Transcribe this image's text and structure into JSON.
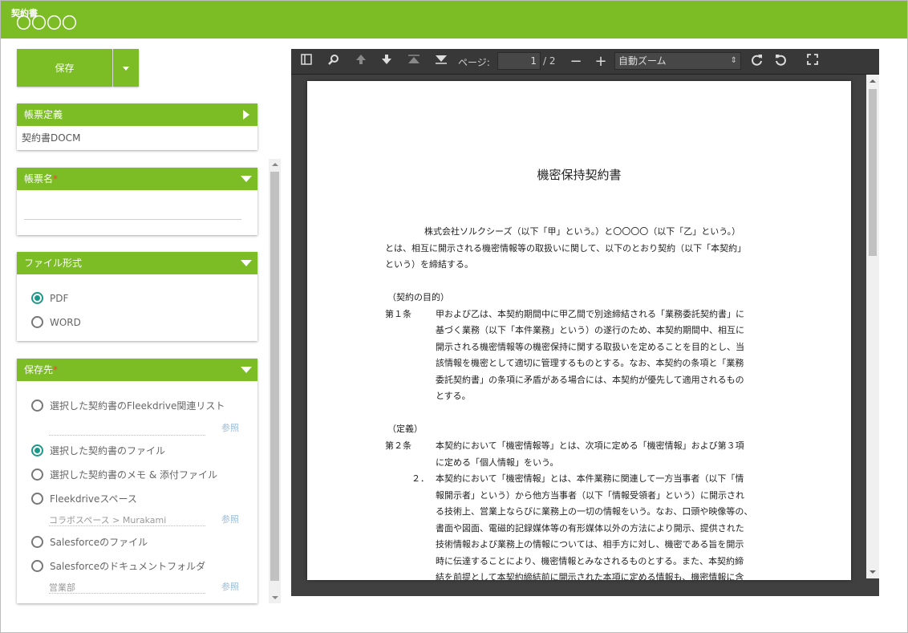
{
  "header": {
    "title": "契約書",
    "subtitle": "〇〇〇〇"
  },
  "toolbar": {
    "save_label": "保存"
  },
  "panels": {
    "definition": {
      "title": "帳票定義",
      "value": "契約書DOCM"
    },
    "name": {
      "title": "帳票名",
      "required_mark": "*",
      "value": ""
    },
    "format": {
      "title": "ファイル形式",
      "options": [
        "PDF",
        "WORD"
      ],
      "selected": "PDF"
    },
    "destination": {
      "title": "保存先",
      "required_mark": "*",
      "options": [
        "選択した契約書のFleekdrive関連リスト",
        "選択した契約書のファイル",
        "選択した契約書のメモ & 添付ファイル",
        "Fleekdriveスペース",
        "Salesforceのファイル",
        "Salesforceのドキュメントフォルダ"
      ],
      "selected": "選択した契約書のファイル",
      "fleekdrive_space_value": "コラボスペース > Murakami",
      "document_folder_value": "営業部",
      "ref_label": "参照"
    }
  },
  "viewer": {
    "page_label": "ページ:",
    "current_page": "1",
    "total_pages": "/ 2",
    "zoom": "自動ズーム",
    "document": {
      "title": "機密保持契約書",
      "lines": [
        "株式会社ソルクシーズ（以下「甲」という。）と〇〇〇〇（以下「乙」という。）",
        "とは、相互に開示される機密情報等の取扱いに関して、以下のとおり契約（以下「本契約」",
        "という）を締結する。",
        "（契約の目的）",
        "第１条",
        "甲および乙は、本契約期間中に甲乙間で別途締結される「業務委託契約書」に",
        "基づく業務（以下「本件業務」という）の遂行のため、本契約期間中、相互に",
        "開示される機密情報等の機密保持に関する取扱いを定めることを目的とし、当",
        "該情報を機密として適切に管理するものとする。なお、本契約の条項と「業務",
        "委託契約書」の条項に矛盾がある場合には、本契約が優先して適用されるもの",
        "とする。",
        "（定義）",
        "第２条",
        "本契約において「機密情報等」とは、次項に定める「機密情報」および第３項",
        "に定める「個人情報」をいう。",
        "２．",
        "本契約において「機密情報」とは、本件業務に関連して一方当事者（以下「情",
        "報開示者」という）から他方当事者（以下「情報受領者」という）に開示され",
        "る技術上、営業上ならびに業務上の一切の情報をいう。なお、口頭や映像等の、",
        "書面や図面、電磁的記録媒体等の有形媒体以外の方法により開示、提供された",
        "技術情報および業務上の情報については、相手方に対し、機密である旨を開示",
        "時に伝達することにより、機密情報とみなされるものとする。また、本契約締",
        "結を前提として本契約締結前に開示された本項に定める情報も、機密情報に含"
      ]
    }
  }
}
